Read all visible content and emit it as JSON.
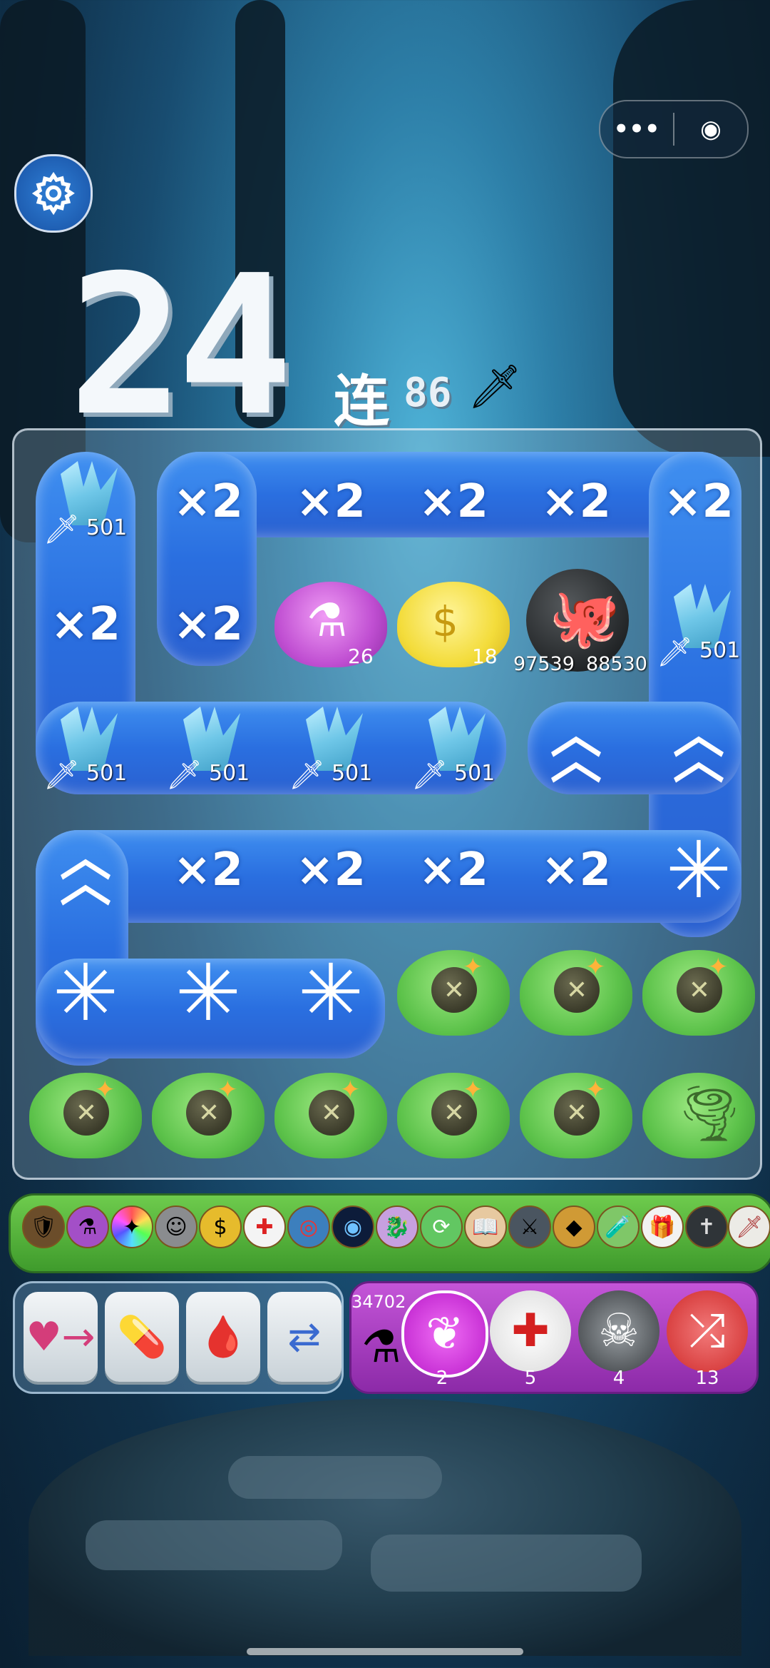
{
  "top": {
    "menu_icon": "more-dots-icon",
    "close_icon": "target-icon",
    "settings_icon": "gear-icon"
  },
  "score": "24",
  "combo": {
    "label": "连",
    "value": "86"
  },
  "board": {
    "multipliers": [
      "×2",
      "×2",
      "×2",
      "×2",
      "×2",
      "×2",
      "×2",
      "×2",
      "×2",
      "×2",
      "×2",
      "×2"
    ],
    "gem_counts": [
      "501",
      "501",
      "501",
      "501",
      "501",
      "501"
    ],
    "potion_count": "26",
    "coin_count": "18",
    "monster": {
      "attack": "97539",
      "hp": "88530"
    }
  },
  "items": [
    "shield-medal",
    "potion-medal",
    "rainbow-medal",
    "old-man-medal",
    "coin-medal",
    "heal-medal",
    "target-medal",
    "vortex-medal",
    "dragon-medal",
    "cycle-medal",
    "book-medal",
    "warrior-medal",
    "gold-pile-medal",
    "bottle-medal",
    "gift-medal",
    "cross-medal",
    "sword-medal"
  ],
  "tools": {
    "left": [
      "swap-potion-icon",
      "pill-bottle-icon",
      "blood-bag-icon",
      "shuffle-dots-icon"
    ]
  },
  "skills": {
    "potion_total": "34702",
    "buttons": [
      {
        "name": "wing-skill",
        "count": "2"
      },
      {
        "name": "heal-skill",
        "count": "5"
      },
      {
        "name": "vampire-skill",
        "count": "4"
      },
      {
        "name": "shuffle-skill",
        "count": "13"
      }
    ]
  },
  "colors": {
    "lane": "#2a6fe0",
    "board_border": "#e6f0f8",
    "item_bar": "#4fae36",
    "skill_panel": "#a93cc0"
  }
}
